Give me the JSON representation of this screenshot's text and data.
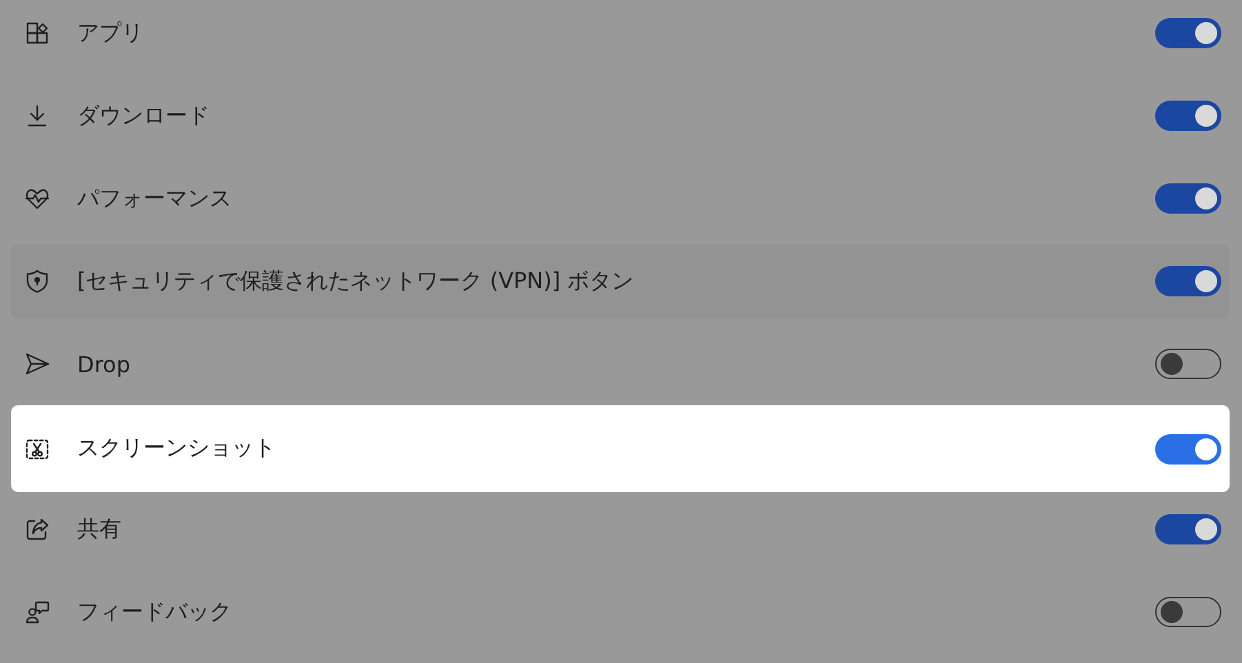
{
  "settings": [
    {
      "kind": "apps",
      "label": "アプリ",
      "on": true,
      "highlighted": false,
      "hovered": false
    },
    {
      "kind": "download",
      "label": "ダウンロード",
      "on": true,
      "highlighted": false,
      "hovered": false
    },
    {
      "kind": "performance",
      "label": "パフォーマンス",
      "on": true,
      "highlighted": false,
      "hovered": false
    },
    {
      "kind": "shield",
      "label": "[セキュリティで保護されたネットワーク (VPN)] ボタン",
      "on": true,
      "highlighted": false,
      "hovered": true
    },
    {
      "kind": "send",
      "label": "Drop",
      "on": false,
      "highlighted": false,
      "hovered": false
    },
    {
      "kind": "screenshot",
      "label": "スクリーンショット",
      "on": true,
      "highlighted": true,
      "hovered": false
    },
    {
      "kind": "share",
      "label": "共有",
      "on": true,
      "highlighted": false,
      "hovered": false
    },
    {
      "kind": "feedback",
      "label": "フィードバック",
      "on": false,
      "highlighted": false,
      "hovered": false
    }
  ]
}
